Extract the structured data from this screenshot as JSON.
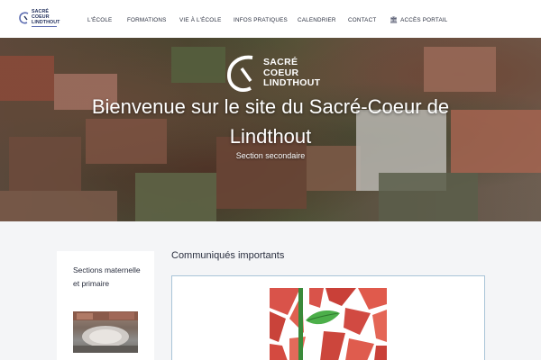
{
  "brand": {
    "logo_lines": [
      "SACRÉ",
      "COEUR",
      "LINDTHOUT"
    ],
    "navy": "#1f2d5a",
    "accent": "#5b6bb0"
  },
  "nav": {
    "items": [
      "L'ÉCOLE",
      "FORMATIONS",
      "VIE À L'ÉCOLE",
      "INFOS PRATIQUES",
      "CALENDRIER",
      "CONTACT"
    ],
    "portal_icon": "house-icon",
    "portal_label": "ACCÈS PORTAIL"
  },
  "hero": {
    "logo_lines": [
      "SACRÉ",
      "COEUR",
      "LINDTHOUT"
    ],
    "title": "Bienvenue sur le site du Sacré-Coeur de Lindthout",
    "subtitle": "Section secondaire"
  },
  "sidebar": {
    "card_title": "Sections maternelle et primaire"
  },
  "main": {
    "section_title": "Communiqués importants"
  }
}
